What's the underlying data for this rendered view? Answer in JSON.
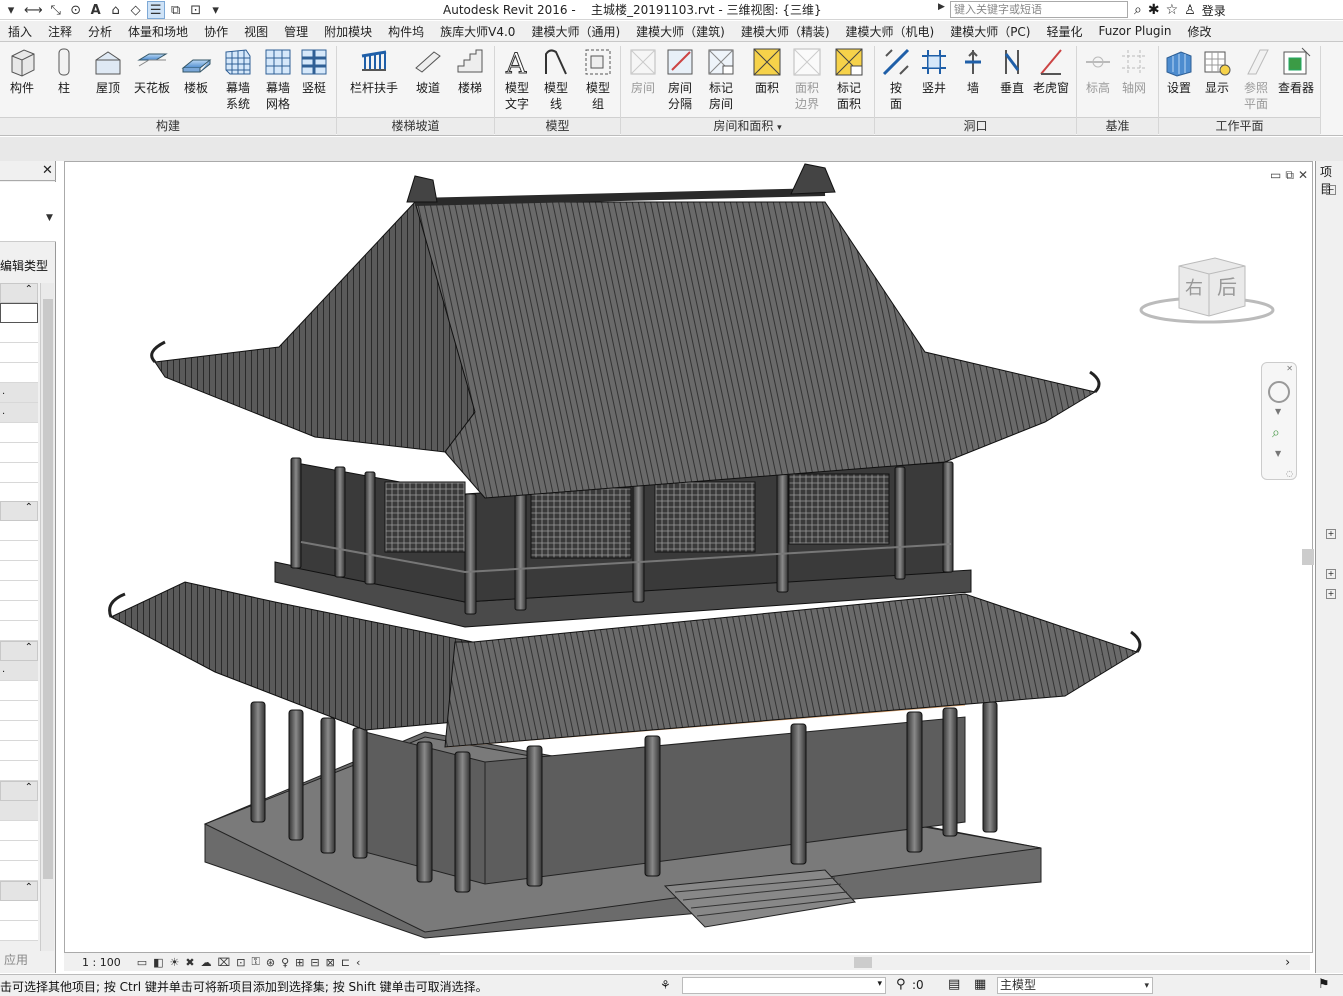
{
  "titlebar": {
    "app": "Autodesk Revit 2016 -",
    "document": "主城楼_20191103.rvt - 三维视图: {三维}",
    "search_placeholder": "键入关键字或短语",
    "login": "登录"
  },
  "menu": [
    "插入",
    "注释",
    "分析",
    "体量和场地",
    "协作",
    "视图",
    "管理",
    "附加模块",
    "构件坞",
    "族库大师V4.0",
    "建模大师（通用)",
    "建模大师（建筑)",
    "建模大师（精装)",
    "建模大师（机电)",
    "建模大师（PC)",
    "轻量化",
    "Fuzor Plugin",
    "修改"
  ],
  "ribbon": {
    "build": {
      "label": "构建",
      "buttons": [
        "构件",
        "柱",
        "屋顶",
        "天花板",
        "楼板",
        "幕墙\n系统",
        "幕墙\n网格",
        "竖梃"
      ]
    },
    "stairs": {
      "label": "楼梯坡道",
      "buttons": [
        "栏杆扶手",
        "坡道",
        "楼梯"
      ]
    },
    "model": {
      "label": "模型",
      "buttons": [
        "模型\n文字",
        "模型\n线",
        "模型\n组"
      ]
    },
    "room": {
      "label": "房间和面积",
      "buttons": [
        "房间",
        "房间\n分隔",
        "标记\n房间",
        "面积",
        "面积\n边界",
        "标记\n面积"
      ]
    },
    "opening": {
      "label": "洞口",
      "buttons": [
        "按\n面",
        "竖井",
        "墙",
        "垂直",
        "老虎窗"
      ]
    },
    "datum": {
      "label": "基准",
      "buttons": [
        "标高",
        "轴网"
      ]
    },
    "workplane": {
      "label": "工作平面",
      "buttons": [
        "设置",
        "显示",
        "参照\n平面",
        "查看器"
      ]
    }
  },
  "left_panel": {
    "edit_type": "编辑类型",
    "apply": "应用"
  },
  "right_panel": {
    "label": "项目"
  },
  "viewcube": {
    "right": "右",
    "back": "后"
  },
  "viewbar": {
    "scale": "1 : 100"
  },
  "status": {
    "text": "击可选择其他项目; 按 Ctrl 键并单击可将新项目添加到选择集; 按 Shift 键单击可取消选择。",
    "filter": ":0",
    "model": "主模型"
  }
}
